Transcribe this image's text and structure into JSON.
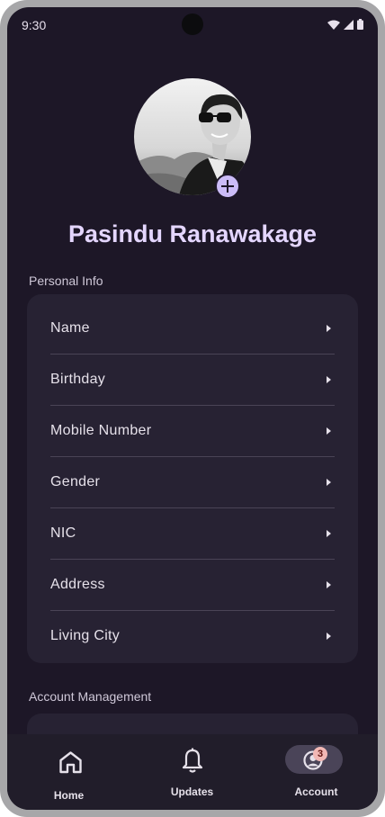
{
  "status_bar": {
    "time": "9:30"
  },
  "profile": {
    "name": "Pasindu Ranawakage"
  },
  "personal_info": {
    "section_label": "Personal Info",
    "rows": [
      {
        "label": "Name"
      },
      {
        "label": "Birthday"
      },
      {
        "label": "Mobile Number"
      },
      {
        "label": "Gender"
      },
      {
        "label": "NIC"
      },
      {
        "label": "Address"
      },
      {
        "label": "Living City"
      }
    ]
  },
  "account_management": {
    "section_label": "Account Management"
  },
  "bottom_nav": {
    "items": [
      {
        "label": "Home",
        "icon": "home-icon"
      },
      {
        "label": "Updates",
        "icon": "bell-icon"
      },
      {
        "label": "Account",
        "icon": "account-icon",
        "badge": "3",
        "active": true
      }
    ]
  },
  "colors": {
    "background": "#1d1727",
    "card": "#272233",
    "accent_name": "#e4d6ff",
    "add_button": "#cbbcf7",
    "badge": "#f2b8b5"
  }
}
